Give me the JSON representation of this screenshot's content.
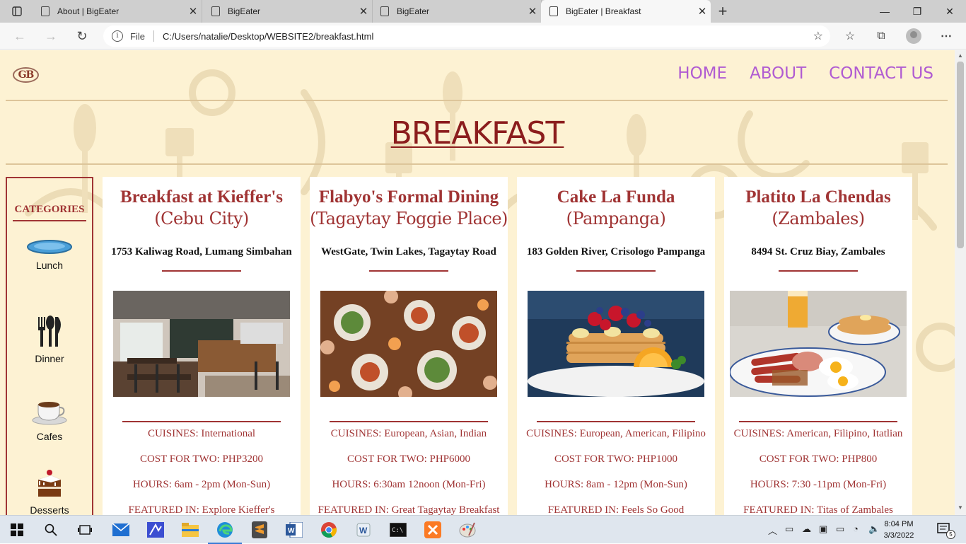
{
  "browser": {
    "tabs": [
      {
        "title": "About | BigEater",
        "active": false
      },
      {
        "title": "BigEater",
        "active": false
      },
      {
        "title": "BigEater",
        "active": false
      },
      {
        "title": "BigEater | Breakfast",
        "active": true
      }
    ],
    "address": {
      "scheme_label": "File",
      "url": "C:/Users/natalie/Desktop/WEBSITE2/breakfast.html"
    }
  },
  "site": {
    "logo_text": "GB",
    "nav": [
      "HOME",
      "ABOUT",
      "CONTACT US"
    ],
    "page_title": "BREAKFAST",
    "colors": {
      "background": "#fdf2d3",
      "accent_red": "#a03434",
      "nav_purple": "#b05bd2",
      "title": "#8b1d1d"
    }
  },
  "sidebar": {
    "heading": "CATEGORIES",
    "items": [
      {
        "label": "Lunch",
        "icon": "plate-icon",
        "selected": false
      },
      {
        "label": "Dinner",
        "icon": "cutlery-icon",
        "selected": false
      },
      {
        "label": "Cafes",
        "icon": "coffee-cup-icon",
        "selected": true
      },
      {
        "label": "Desserts",
        "icon": "cake-icon",
        "selected": false
      }
    ]
  },
  "restaurants": [
    {
      "name": "Breakfast at Kieffer's",
      "location": "(Cebu City)",
      "address": "1753 Kaliwag Road, Lumang Simbahan",
      "photo": "restaurant-interior-photo",
      "cuisines": "CUISINES: International",
      "cost": "COST FOR TWO: PHP3200",
      "hours": "HOURS: 6am - 2pm (Mon-Sun)",
      "featured": "FEATURED IN: Explore Kieffer's"
    },
    {
      "name": "Flabyo's Formal Dining",
      "location": "(Tagaytay Foggie Place)",
      "address": "WestGate, Twin Lakes, Tagaytay Road",
      "photo": "shared-table-food-photo",
      "cuisines": "CUISINES: European, Asian, Indian",
      "cost": "COST FOR TWO: PHP6000",
      "hours": "HOURS: 6:30am 12noon (Mon-Fri)",
      "featured": "FEATURED IN: Great Tagaytay Breakfast"
    },
    {
      "name": "Cake La Funda",
      "location": "(Pampanga)",
      "address": "183 Golden River, Crisologo Pampanga",
      "photo": "pancake-stack-photo",
      "cuisines": "CUISINES: European, American, Filipino",
      "cost": "COST FOR TWO: PHP1000",
      "hours": "HOURS: 8am - 12pm (Mon-Sun)",
      "featured": "FEATURED IN: Feels So Good"
    },
    {
      "name": "Platito La Chendas",
      "location": "(Zambales)",
      "address": "8494 St. Cruz Biay, Zambales",
      "photo": "breakfast-platter-photo",
      "cuisines": "CUISINES: American, Filipino, Itatlian",
      "cost": "COST FOR TWO: PHP800",
      "hours": "HOURS: 7:30 -11pm (Mon-Fri)",
      "featured": "FEATURED IN: Titas of Zambales"
    }
  ],
  "taskbar": {
    "time": "8:04 PM",
    "date": "3/3/2022",
    "notification_count": "5"
  }
}
